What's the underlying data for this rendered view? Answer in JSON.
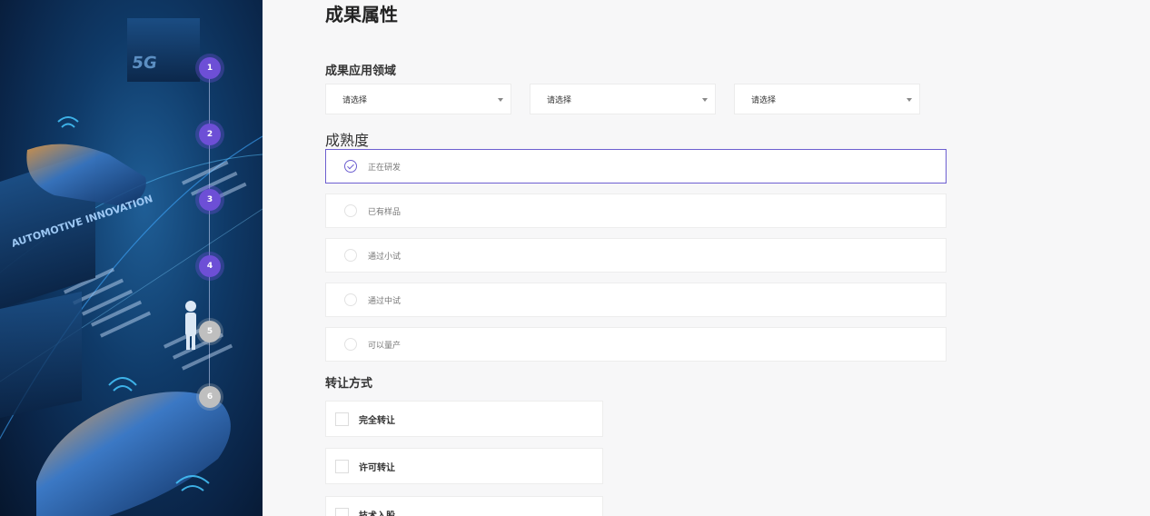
{
  "hero": {
    "banner_text": "5G",
    "sign_text": "AUTOMOTIVE INNOVATION",
    "steps": [
      {
        "number": "1",
        "state": "active"
      },
      {
        "number": "2",
        "state": "active"
      },
      {
        "number": "3",
        "state": "active"
      },
      {
        "number": "4",
        "state": "active"
      },
      {
        "number": "5",
        "state": "inactive"
      },
      {
        "number": "6",
        "state": "inactive"
      }
    ]
  },
  "form": {
    "title": "成果属性",
    "application_field": {
      "label": "成果应用领域",
      "selects": [
        "请选择",
        "请选择",
        "请选择"
      ]
    },
    "maturity": {
      "label": "成熟度",
      "options": [
        {
          "label": "正在研发",
          "selected": true
        },
        {
          "label": "已有样品",
          "selected": false
        },
        {
          "label": "通过小试",
          "selected": false
        },
        {
          "label": "通过中试",
          "selected": false
        },
        {
          "label": "可以量产",
          "selected": false
        }
      ]
    },
    "transfer": {
      "label": "转让方式",
      "options": [
        {
          "label": "完全转让",
          "checked": false
        },
        {
          "label": "许可转让",
          "checked": false
        },
        {
          "label": "技术入股",
          "checked": false
        }
      ]
    }
  },
  "colors": {
    "accent": "#6d4fd6",
    "step_inactive": "#bfbfbf",
    "page_bg": "#f7f7f8"
  }
}
